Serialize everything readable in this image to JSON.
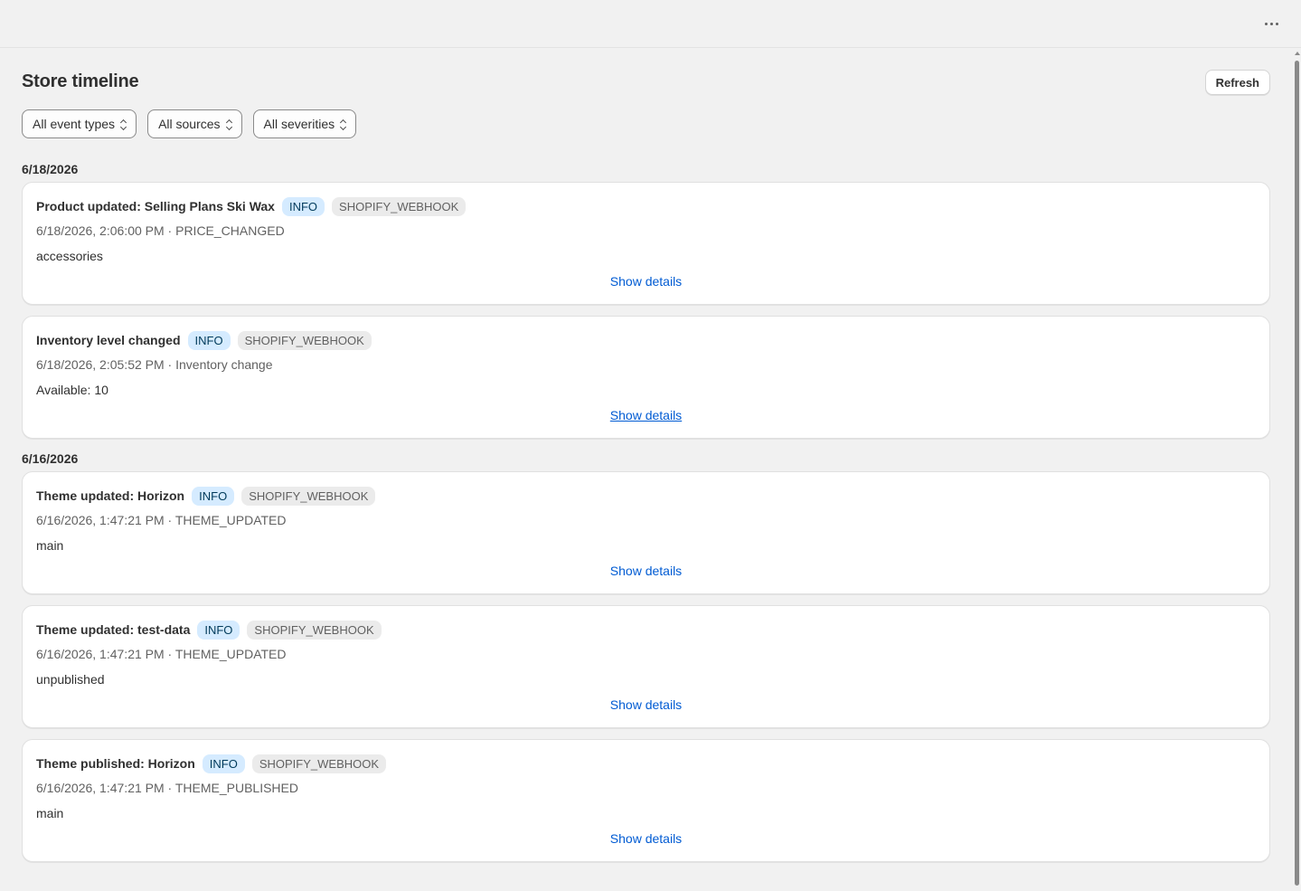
{
  "page": {
    "title": "Store timeline",
    "refresh_label": "Refresh"
  },
  "filters": [
    {
      "label": "All event types"
    },
    {
      "label": "All sources"
    },
    {
      "label": "All severities"
    }
  ],
  "groups": [
    {
      "date": "6/18/2026",
      "events": [
        {
          "title": "Product updated: Selling Plans Ski Wax",
          "severity": "INFO",
          "source": "SHOPIFY_WEBHOOK",
          "meta": "6/18/2026, 2:06:00 PM · PRICE_CHANGED",
          "description": "accessories",
          "link": "Show details"
        },
        {
          "title": "Inventory level changed",
          "severity": "INFO",
          "source": "SHOPIFY_WEBHOOK",
          "meta": "6/18/2026, 2:05:52 PM · Inventory change",
          "description": "Available: 10",
          "link": "Show details"
        }
      ]
    },
    {
      "date": "6/16/2026",
      "events": [
        {
          "title": "Theme updated: Horizon",
          "severity": "INFO",
          "source": "SHOPIFY_WEBHOOK",
          "meta": "6/16/2026, 1:47:21 PM · THEME_UPDATED",
          "description": "main",
          "link": "Show details"
        },
        {
          "title": "Theme updated: test-data",
          "severity": "INFO",
          "source": "SHOPIFY_WEBHOOK",
          "meta": "6/16/2026, 1:47:21 PM · THEME_UPDATED",
          "description": "unpublished",
          "link": "Show details"
        },
        {
          "title": "Theme published: Horizon",
          "severity": "INFO",
          "source": "SHOPIFY_WEBHOOK",
          "meta": "6/16/2026, 1:47:21 PM · THEME_PUBLISHED",
          "description": "main",
          "link": "Show details"
        }
      ]
    }
  ],
  "colors": {
    "link": "#005bd3",
    "info_badge_bg": "#d5ebff",
    "source_badge_bg": "#ebebeb",
    "page_bg": "#f1f1f1"
  },
  "icons": {
    "more": "more-horizontal-icon",
    "select": "select-chevrons-icon"
  }
}
